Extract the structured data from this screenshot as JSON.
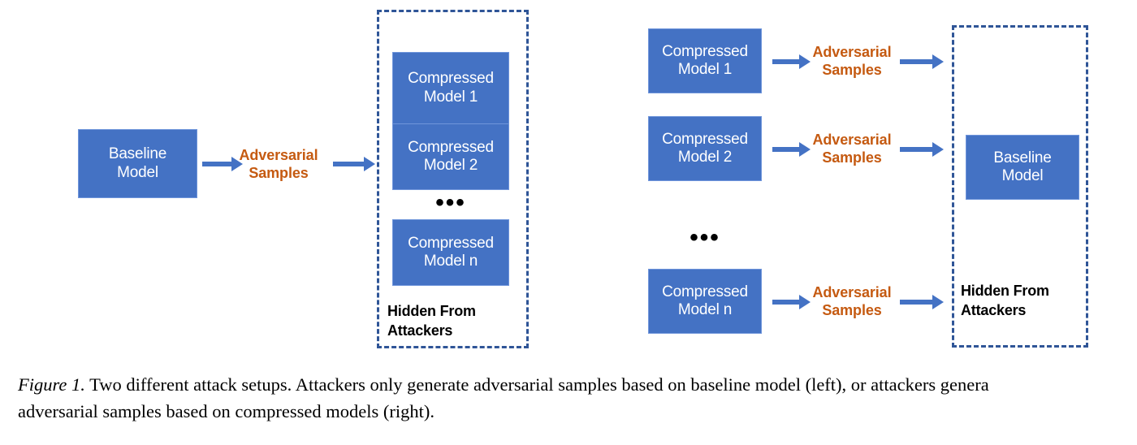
{
  "figure": {
    "caption_label": "Figure 1.",
    "caption_line1": " Two different attack setups. Attackers only generate adversarial samples based on baseline model (left), or attackers genera",
    "caption_line2": "adversarial samples based on compressed models (right)."
  },
  "colors": {
    "model_box_fill": "#4472C4",
    "model_box_border": "#6F95DB",
    "model_box_text": "#FFFFFF",
    "adversarial_text": "#C55A11",
    "arrow": "#4472C4",
    "dashed_border": "#2F5597",
    "hidden_label_text": "#000000",
    "background": "#FFFFFF"
  },
  "left_setup": {
    "baseline_model": {
      "line1": "Baseline",
      "line2": "Model"
    },
    "adversarial_samples": {
      "line1": "Adversarial",
      "line2": "Samples"
    },
    "arrow_in_icon": "arrow-right-icon",
    "arrow_out_icon": "arrow-right-icon",
    "hidden_box": {
      "models": [
        {
          "line1": "Compressed",
          "line2": "Model 1"
        },
        {
          "line1": "Compressed",
          "line2": "Model 2"
        },
        {
          "line1": "Compressed",
          "line2": "Model n"
        }
      ],
      "ellipsis": "•••",
      "hidden_label": {
        "line1": "Hidden From",
        "line2": "Attackers"
      }
    }
  },
  "right_setup": {
    "rows": [
      {
        "model": {
          "line1": "Compressed",
          "line2": "Model 1"
        },
        "adversarial_samples": {
          "line1": "Adversarial",
          "line2": "Samples"
        }
      },
      {
        "model": {
          "line1": "Compressed",
          "line2": "Model 2"
        },
        "adversarial_samples": {
          "line1": "Adversarial",
          "line2": "Samples"
        }
      },
      {
        "model": {
          "line1": "Compressed",
          "line2": "Model n"
        },
        "adversarial_samples": {
          "line1": "Adversarial",
          "line2": "Samples"
        }
      }
    ],
    "ellipsis": "•••",
    "hidden_box": {
      "baseline_model": {
        "line1": "Baseline",
        "line2": "Model"
      },
      "hidden_label": {
        "line1": "Hidden From",
        "line2": "Attackers"
      }
    }
  }
}
